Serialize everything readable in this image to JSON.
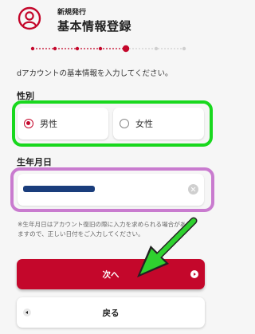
{
  "header": {
    "subtitle": "新規発行",
    "title": "基本情報登録",
    "icon": "user-circle-icon"
  },
  "progress": {
    "total_steps": 8,
    "current_step": 5
  },
  "intro_text": "dアカウントの基本情報を入力してください。",
  "gender": {
    "label": "性別",
    "options": [
      {
        "label": "男性",
        "checked": true
      },
      {
        "label": "女性",
        "checked": false
      }
    ]
  },
  "dob": {
    "label": "生年月日",
    "clear_icon": "clear-circle-icon"
  },
  "note": "※生年月日はアカウント復旧の際に入力を求められる場合がありますので、正しい日付をご入力してください。",
  "buttons": {
    "next_label": "次へ",
    "back_label": "戻る"
  },
  "colors": {
    "accent": "#c4072b",
    "gender_highlight": "#19d81e",
    "dob_highlight": "#c97bcf",
    "arrow": "#2fd12f"
  }
}
